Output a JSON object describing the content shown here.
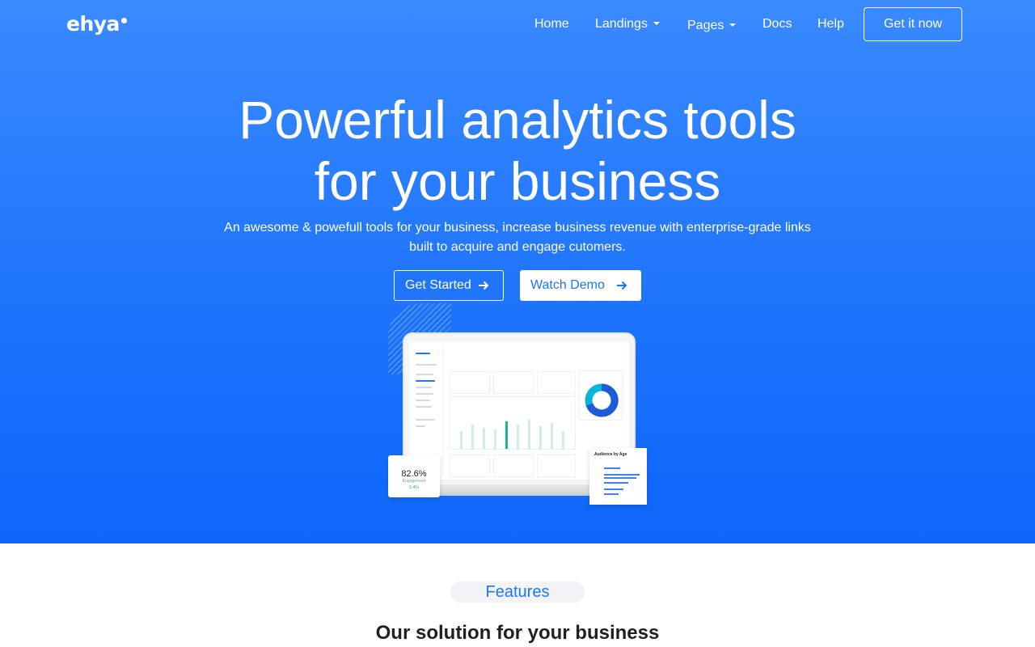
{
  "brand": {
    "logo_text": "ehya"
  },
  "nav": {
    "items": [
      {
        "label": "Home",
        "dropdown": false
      },
      {
        "label": "Landings",
        "dropdown": true
      },
      {
        "label": "Pages",
        "dropdown": true
      },
      {
        "label": "Docs",
        "dropdown": false
      },
      {
        "label": "Help",
        "dropdown": false
      }
    ],
    "cta_label": "Get it now"
  },
  "hero": {
    "title_line1": "Powerful analytics tools",
    "title_line2": "for your business",
    "subtitle": "An awesome & powefull tools for your business, increase business revenue with enterprise-grade links built to acquire and engage cutomers.",
    "primary_button": "Get Started",
    "secondary_button": "Watch Demo",
    "mockup": {
      "stat_value": "82.6%",
      "stat_label": "Engagement",
      "stat_change": "5.4%",
      "age_card_title": "Audience by Age"
    }
  },
  "features": {
    "pill": "Features",
    "heading": "Our solution for your business"
  },
  "colors": {
    "hero_top": "#3a8aff",
    "hero_bottom": "#0e66fb",
    "accent": "#1e74fb",
    "success": "#1db58b"
  },
  "icons": {
    "arrow": "arrow-right-icon",
    "caret": "caret-down-icon",
    "logo_dot": "logo-dot"
  }
}
